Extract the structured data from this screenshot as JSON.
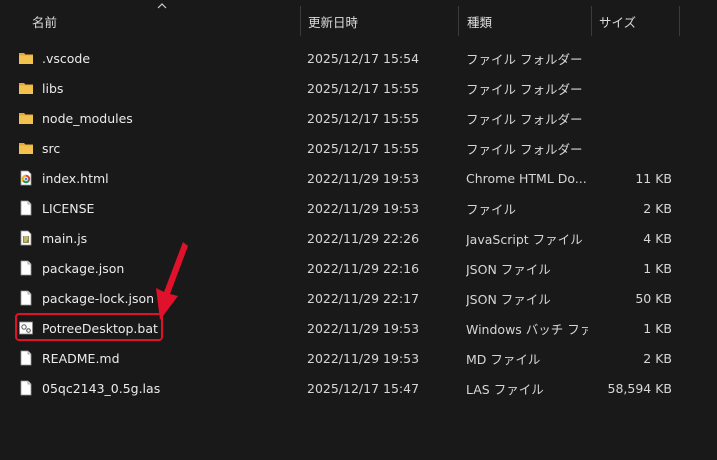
{
  "headers": {
    "name": "名前",
    "date": "更新日時",
    "type": "種類",
    "size": "サイズ"
  },
  "files": [
    {
      "name": ".vscode",
      "date": "2025/12/17 15:54",
      "type": "ファイル フォルダー",
      "size": "",
      "icon": "folder-icon"
    },
    {
      "name": "libs",
      "date": "2025/12/17 15:55",
      "type": "ファイル フォルダー",
      "size": "",
      "icon": "folder-icon"
    },
    {
      "name": "node_modules",
      "date": "2025/12/17 15:55",
      "type": "ファイル フォルダー",
      "size": "",
      "icon": "folder-icon"
    },
    {
      "name": "src",
      "date": "2025/12/17 15:55",
      "type": "ファイル フォルダー",
      "size": "",
      "icon": "folder-icon"
    },
    {
      "name": "index.html",
      "date": "2022/11/29 19:53",
      "type": "Chrome HTML Do...",
      "size": "11 KB",
      "icon": "chrome-html-icon"
    },
    {
      "name": "LICENSE",
      "date": "2022/11/29 19:53",
      "type": "ファイル",
      "size": "2 KB",
      "icon": "file-icon"
    },
    {
      "name": "main.js",
      "date": "2022/11/29 22:26",
      "type": "JavaScript ファイル",
      "size": "4 KB",
      "icon": "javascript-file-icon"
    },
    {
      "name": "package.json",
      "date": "2022/11/29 22:16",
      "type": "JSON ファイル",
      "size": "1 KB",
      "icon": "file-icon"
    },
    {
      "name": "package-lock.json",
      "date": "2022/11/29 22:17",
      "type": "JSON ファイル",
      "size": "50 KB",
      "icon": "file-icon"
    },
    {
      "name": "PotreeDesktop.bat",
      "date": "2022/11/29 19:53",
      "type": "Windows バッチ ファ...",
      "size": "1 KB",
      "icon": "batch-file-icon"
    },
    {
      "name": "README.md",
      "date": "2022/11/29 19:53",
      "type": "MD ファイル",
      "size": "2 KB",
      "icon": "file-icon"
    },
    {
      "name": "05qc2143_0.5g.las",
      "date": "2025/12/17 15:47",
      "type": "LAS ファイル",
      "size": "58,594 KB",
      "icon": "file-icon"
    }
  ],
  "colors": {
    "background": "#191919",
    "folder": "#f2c14e",
    "highlight": "#e0112b"
  }
}
